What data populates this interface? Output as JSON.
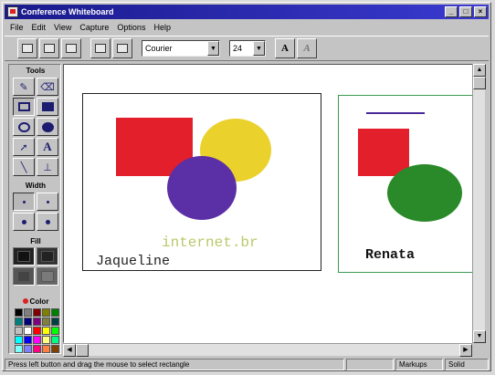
{
  "window": {
    "title": "Conference Whiteboard",
    "controls": [
      "_",
      "□",
      "×"
    ]
  },
  "menu": [
    "File",
    "Edit",
    "View",
    "Capture",
    "Options",
    "Help"
  ],
  "toolbar": {
    "buttons": [
      "cut-icon",
      "copy-icon",
      "paste-icon",
      "page-icon",
      "page-alt-icon"
    ],
    "font": "Courier",
    "font_size": "24",
    "bold_label": "A",
    "italic_label": "A"
  },
  "panel": {
    "tools_label": "Tools",
    "width_label": "Width",
    "fill_label": "Fill",
    "color_label": "Color"
  },
  "palette": [
    "#000000",
    "#7f7f7f",
    "#7f0000",
    "#7f7f00",
    "#007f00",
    "#007f7f",
    "#00007f",
    "#7f007f",
    "#7f7f40",
    "#004040",
    "#c0c0c0",
    "#ffffff",
    "#ff0000",
    "#ffff00",
    "#00ff00",
    "#00ffff",
    "#0000ff",
    "#ff00ff",
    "#ffff80",
    "#00ff80",
    "#80ffff",
    "#8080ff",
    "#ff0080",
    "#ff8040",
    "#804000"
  ],
  "whiteboard": {
    "box_a": {
      "text_internet": "internet.br",
      "text_name": "Jaqueline"
    },
    "box_b": {
      "text_name": "Renata"
    },
    "colors": {
      "red": "#e41f2c",
      "yellow": "#ead12c",
      "purple": "#5b2fa6",
      "green": "#2a8a2a"
    }
  },
  "status": {
    "message": "Press left button and drag the mouse to select rectangle",
    "mode": "Markups",
    "line_style": "Solid"
  }
}
